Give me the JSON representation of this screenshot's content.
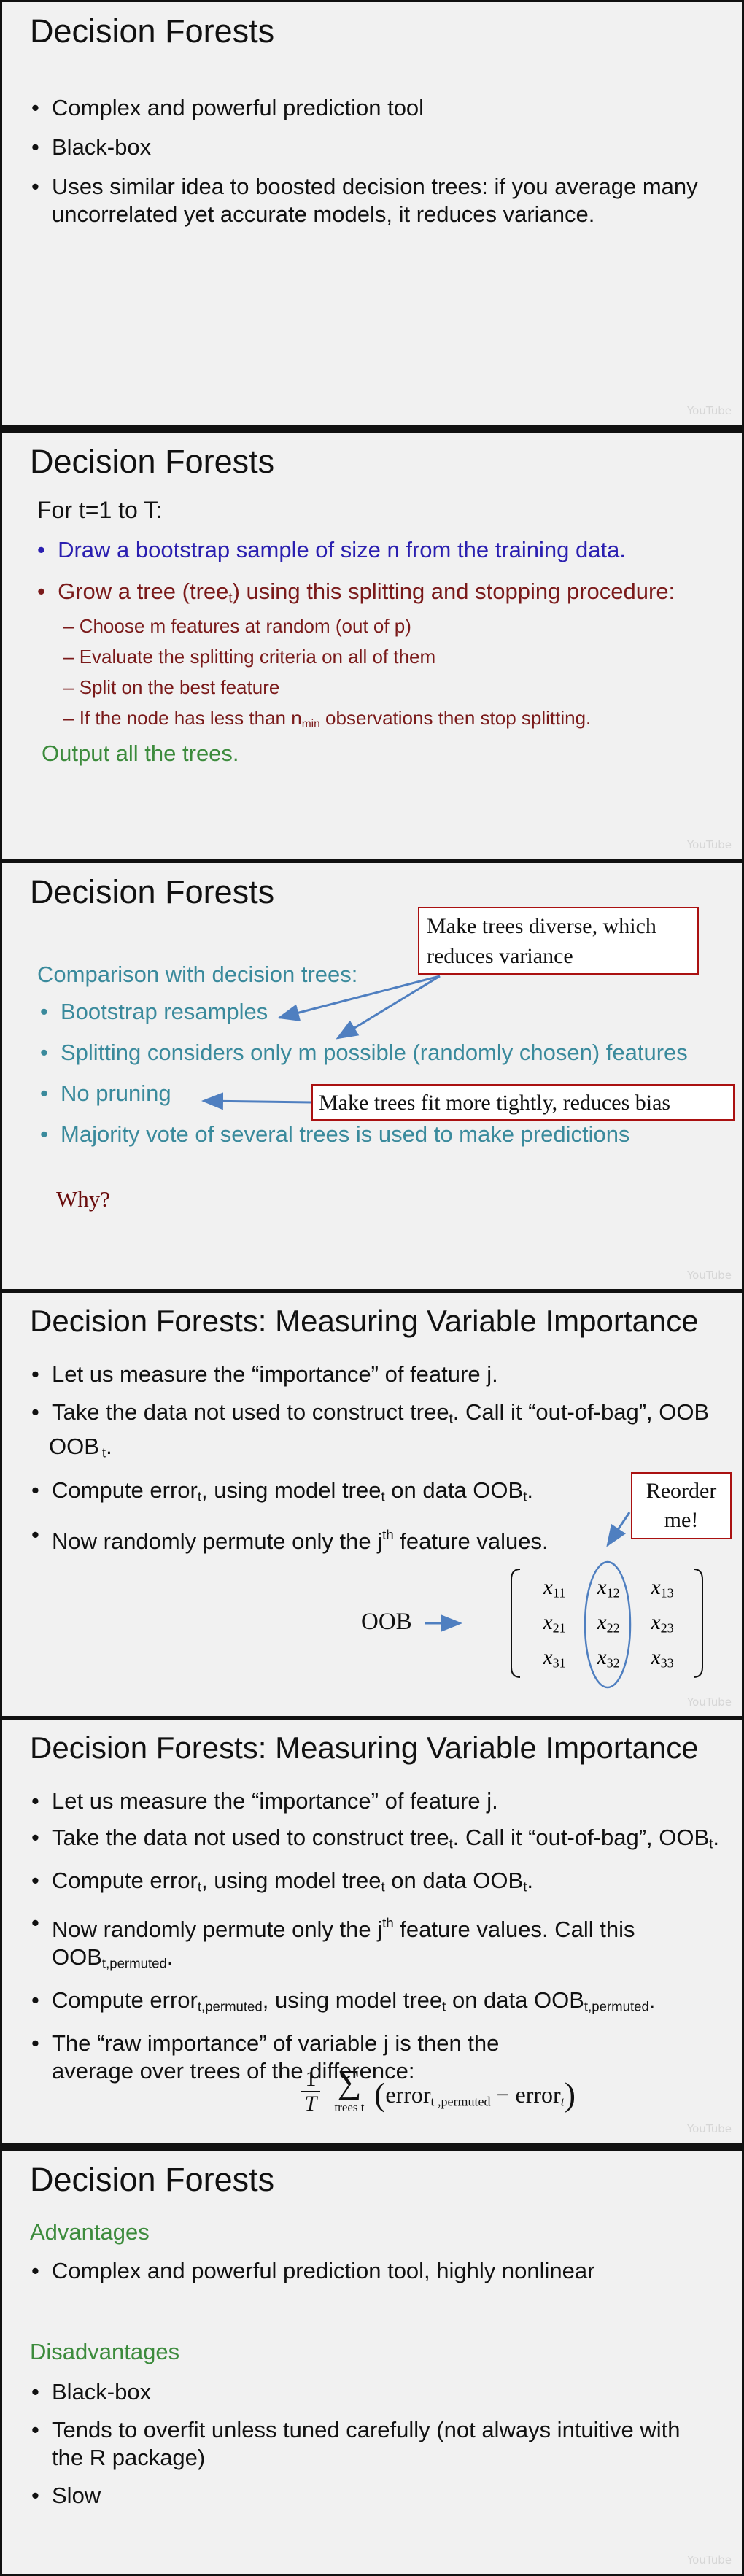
{
  "watermark": "YouTube",
  "slide1": {
    "title": "Decision Forests",
    "bullets": [
      "Complex and powerful prediction tool",
      "Black-box",
      "Uses similar idea to boosted decision trees: if you average many uncorrelated yet accurate models, it reduces variance."
    ]
  },
  "slide2": {
    "title": "Decision Forests",
    "loop": "For t=1 to T:",
    "step1": "Draw a bootstrap sample of size n from the training data.",
    "step2_a": "Grow a tree (tree",
    "step2_sub": "t",
    "step2_b": ") using this splitting and stopping procedure:",
    "sub1": "Choose m features at random (out of p)",
    "sub2": "Evaluate the splitting criteria on all of them",
    "sub3": "Split on the best feature",
    "sub4_a": "If the node has less than n",
    "sub4_sub": "min",
    "sub4_b": " observations then stop splitting.",
    "output": "Output all the trees.",
    "colors": {
      "blue": "#2a1fb0",
      "red": "#7a1a1a",
      "green": "#3c8b3c"
    }
  },
  "slide3": {
    "title": "Decision Forests",
    "callout1": "Make trees diverse, which reduces variance",
    "intro": "Comparison with decision trees:",
    "bullets": [
      "Bootstrap resamples",
      "Splitting considers only m possible (randomly chosen) features",
      "No pruning",
      "Majority vote of several trees is used to make predictions"
    ],
    "callout2": "Make trees fit more tightly, reduces bias",
    "why": "Why?",
    "colors": {
      "teal": "#3a8a9c",
      "maroon": "#6a0d0d"
    }
  },
  "slide4": {
    "title": "Decision Forests: Measuring Variable Importance",
    "b1": "Let us measure the “importance” of feature j.",
    "b2_a": "Take the data not used to construct tree",
    "b2_sub": "t",
    "b2_b": ". Call it “out-of-bag”, OOB",
    "b2_sub2": "t",
    "b2_c": ".",
    "b3_a": "Compute error",
    "b3_sub": "t",
    "b3_b": ", using model tree",
    "b3_sub2": "t",
    "b3_c": " on data OOB",
    "b3_sub3": "t",
    "b3_d": ".",
    "b4_a": "Now randomly permute only the j",
    "b4_sup": "th",
    "b4_b": " feature values.",
    "reorder": "Reorder me!",
    "oob": "OOB",
    "matrix": [
      [
        {
          "v": "x",
          "s": "11"
        },
        {
          "v": "x",
          "s": "12"
        },
        {
          "v": "x",
          "s": "13"
        }
      ],
      [
        {
          "v": "x",
          "s": "21"
        },
        {
          "v": "x",
          "s": "22"
        },
        {
          "v": "x",
          "s": "23"
        }
      ],
      [
        {
          "v": "x",
          "s": "31"
        },
        {
          "v": "x",
          "s": "32"
        },
        {
          "v": "x",
          "s": "33"
        }
      ]
    ]
  },
  "slide5": {
    "title": "Decision Forests: Measuring Variable Importance",
    "b1": "Let us measure the “importance” of feature j.",
    "b2_a": "Take the data not used to construct tree",
    "b2_sub": "t",
    "b2_b": ". Call it “out-of-bag”, OOB",
    "b2_sub2": "t",
    "b2_c": ".",
    "b3_a": "Compute error",
    "b3_sub": "t",
    "b3_b": ", using model tree",
    "b3_sub2": "t",
    "b3_c": " on data OOB",
    "b3_sub3": "t",
    "b3_d": ".",
    "b4_a": "Now randomly permute only the j",
    "b4_sup": "th",
    "b4_b": " feature values. Call this OOB",
    "b4_sub": "t,permuted",
    "b4_c": ".",
    "b5_a": "Compute error",
    "b5_sub": "t,permuted",
    "b5_b": ", using model tree",
    "b5_sub2": "t",
    "b5_c": " on data OOB",
    "b5_sub3": "t,permuted",
    "b5_d": ".",
    "b6": "The “raw importance” of variable j is then the average over trees of the difference:",
    "formula": {
      "one": "1",
      "T": "T",
      "sigma": "∑",
      "under": "trees t",
      "lparen": "(",
      "err1": "error",
      "err1_sub": "t ,permuted",
      "minus": "−",
      "err2": "error",
      "err2_sub": "t",
      "rparen": ")"
    }
  },
  "slide6": {
    "title": "Decision Forests",
    "adv_heading": "Advantages",
    "adv_items": [
      "Complex and powerful prediction tool, highly nonlinear"
    ],
    "dis_heading": "Disadvantages",
    "dis_items": [
      "Black-box",
      "Tends to overfit unless tuned carefully (not always intuitive with the R package)",
      "Slow"
    ],
    "colors": {
      "green": "#3c8b3c"
    }
  }
}
